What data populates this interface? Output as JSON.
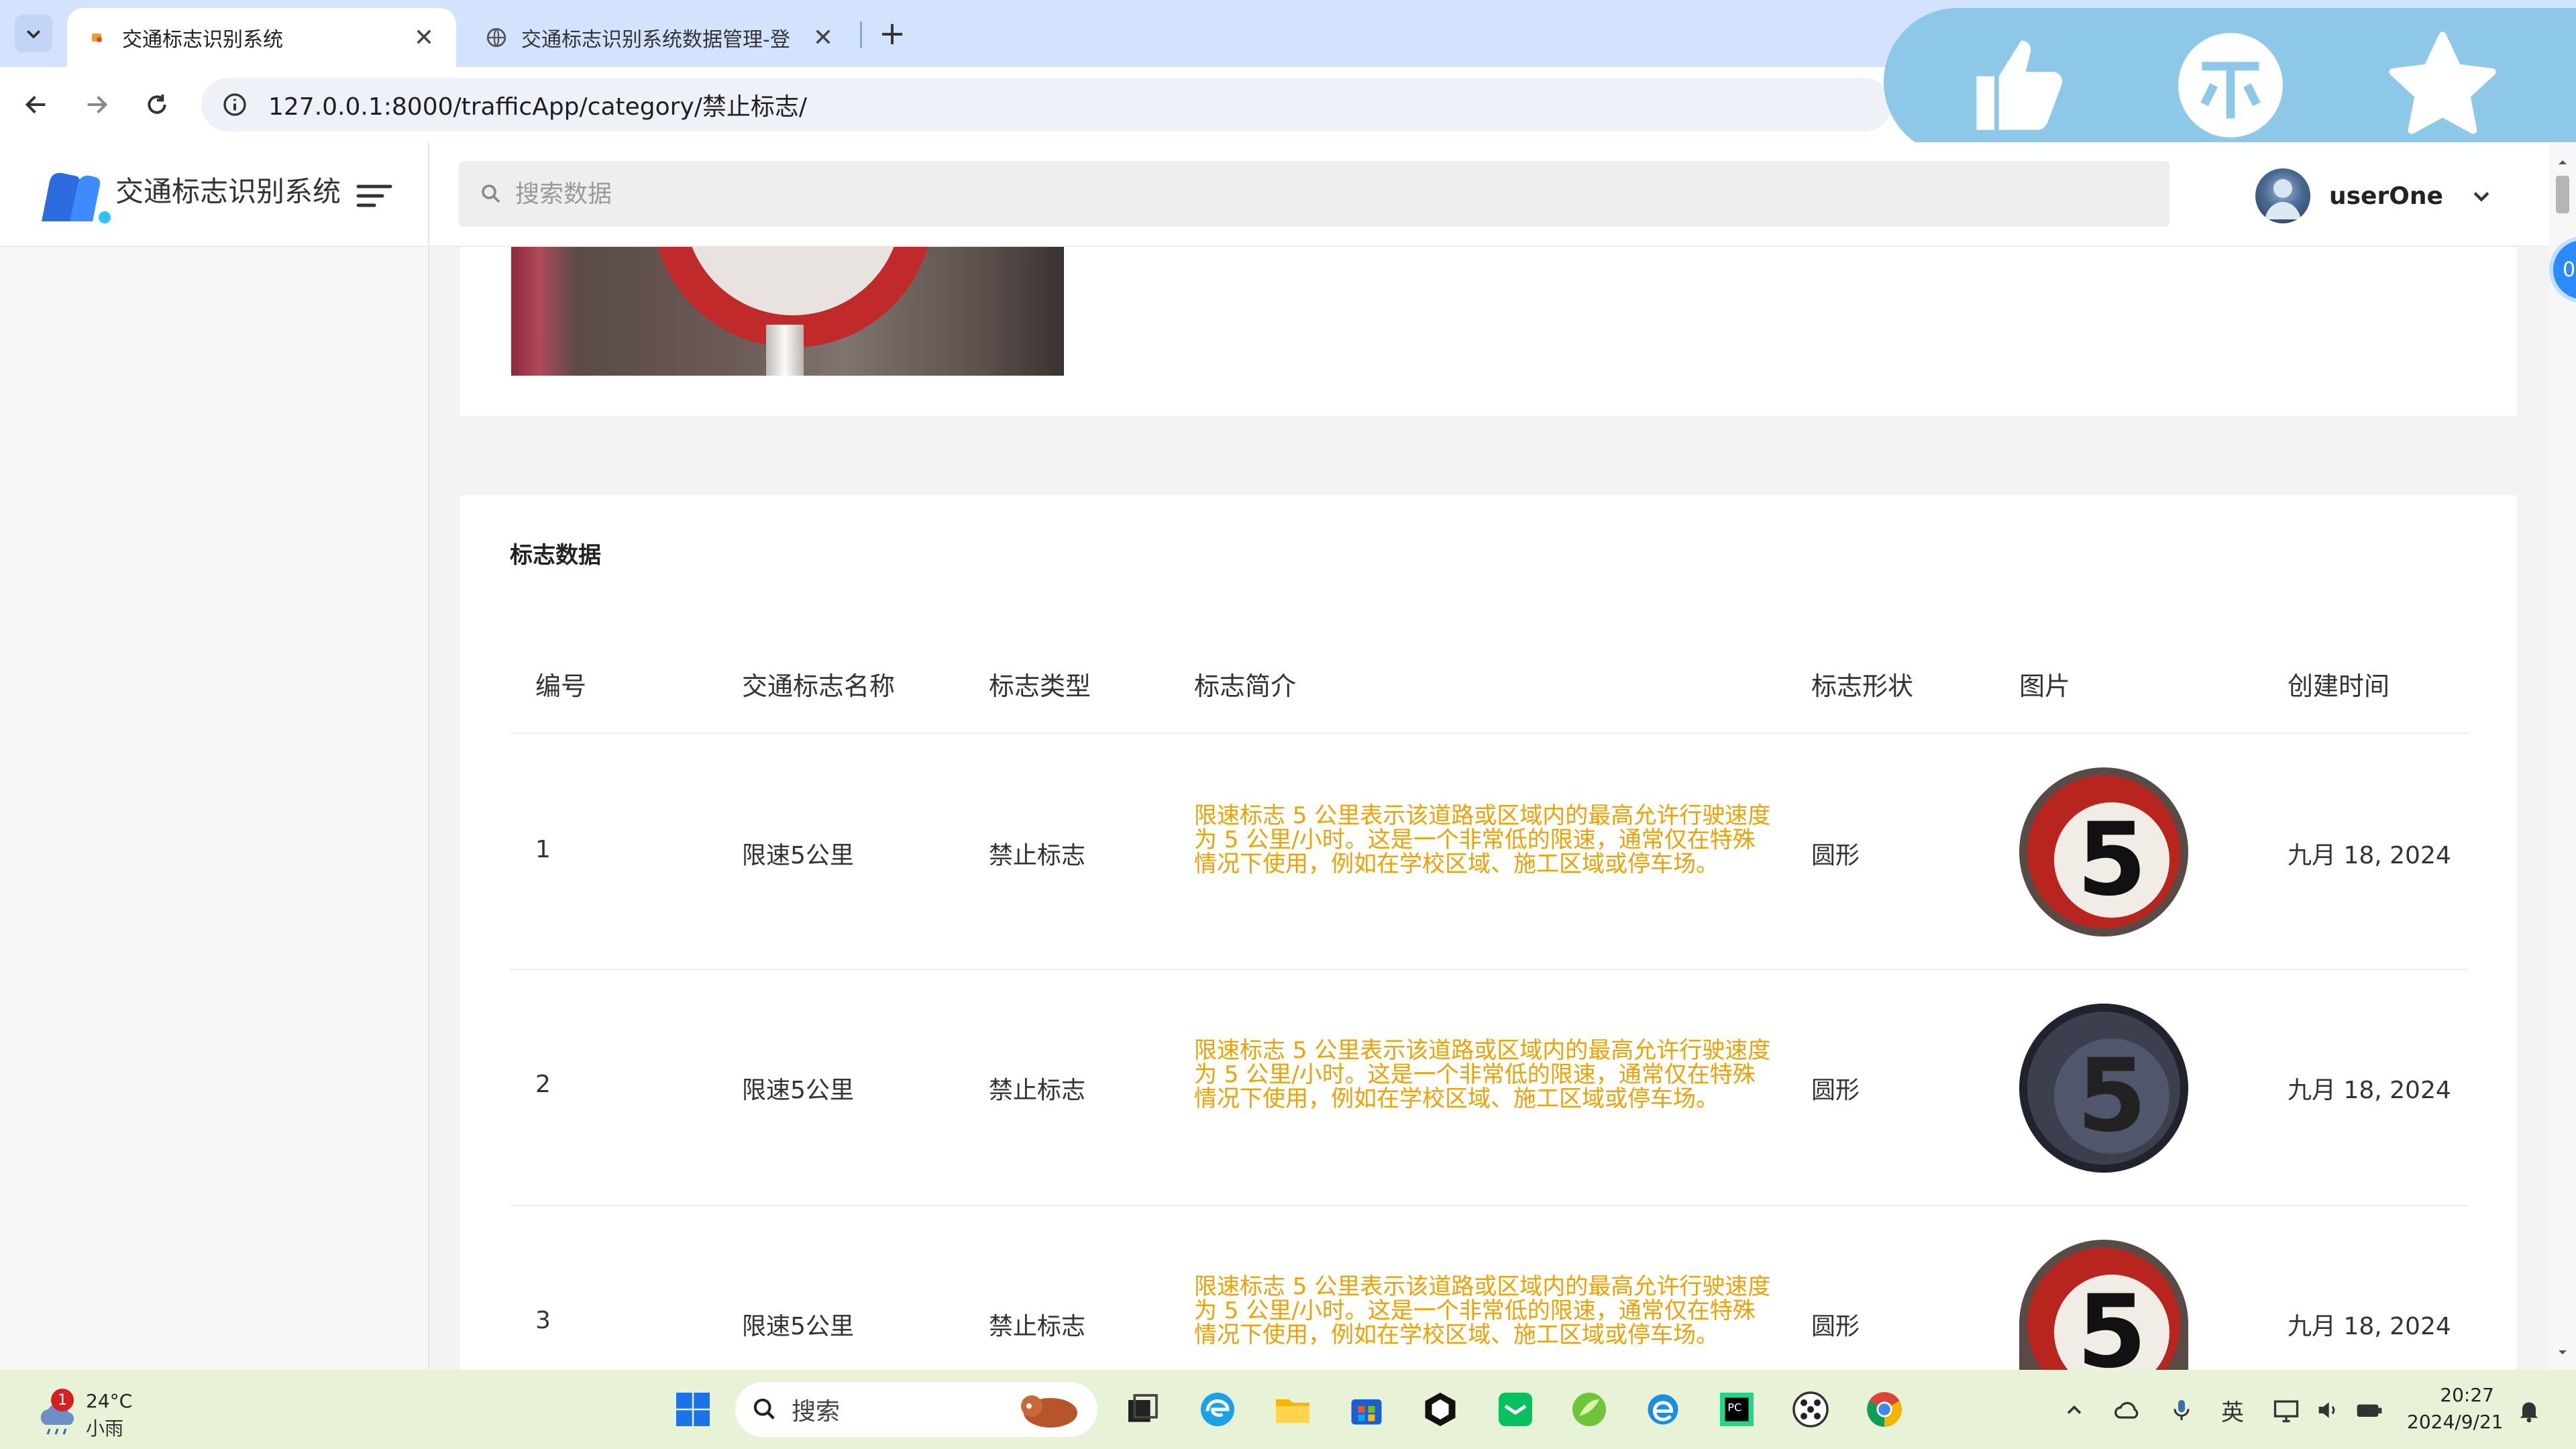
{
  "browser": {
    "tabs": [
      {
        "title": "交通标志识别系统",
        "active": true
      },
      {
        "title": "交通标志识别系统数据管理-登",
        "active": false
      }
    ],
    "new_tab": "+",
    "url": "127.0.0.1:8000/trafficApp/category/禁止标志/"
  },
  "app": {
    "brand": "交通标志识别系统",
    "search_placeholder": "搜索数据",
    "username": "userOne"
  },
  "edge_bubble": "0",
  "table": {
    "title": "标志数据",
    "headers": [
      "编号",
      "交通标志名称",
      "标志类型",
      "标志简介",
      "标志形状",
      "图片",
      "创建时间"
    ],
    "rows": [
      {
        "id": "1",
        "name": "限速5公里",
        "type": "禁止标志",
        "desc": "限速标志 5 公里表示该道路或区域内的最高允许行驶速度为 5 公里/小时。这是一个非常低的限速，通常仅在特殊情况下使用，例如在学校区域、施工区域或停车场。",
        "shape": "圆形",
        "image_digit": "5",
        "created": "九月 18, 2024"
      },
      {
        "id": "2",
        "name": "限速5公里",
        "type": "禁止标志",
        "desc": "限速标志 5 公里表示该道路或区域内的最高允许行驶速度为 5 公里/小时。这是一个非常低的限速，通常仅在特殊情况下使用，例如在学校区域、施工区域或停车场。",
        "shape": "圆形",
        "image_digit": "5",
        "created": "九月 18, 2024"
      },
      {
        "id": "3",
        "name": "限速5公里",
        "type": "禁止标志",
        "desc": "限速标志 5 公里表示该道路或区域内的最高允许行驶速度为 5 公里/小时。这是一个非常低的限速，通常仅在特殊情况下使用，例如在学校区域、施工区域或停车场。",
        "shape": "圆形",
        "image_digit": "5",
        "created": "九月 18, 2024"
      }
    ]
  },
  "taskbar": {
    "weather_temp": "24°C",
    "weather_cond": "小雨",
    "weather_badge": "1",
    "search_label": "搜索",
    "ime": "英",
    "time": "20:27",
    "date": "2024/9/21"
  },
  "colors": {
    "desc_text": "#f0a000",
    "tabbar": "#d3e3fd",
    "overlay": "#8ec8e8",
    "taskbar": "#e8f2d6"
  }
}
